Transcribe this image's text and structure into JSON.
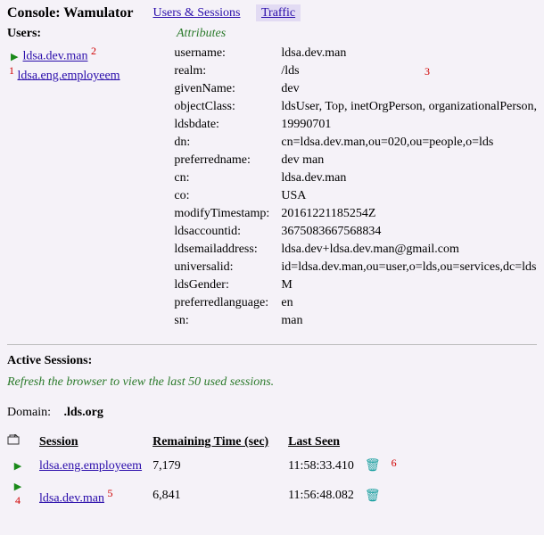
{
  "header": {
    "title": "Console: Wamulator"
  },
  "tabs": {
    "users_sessions": "Users & Sessions",
    "traffic": "Traffic"
  },
  "labels": {
    "users": "Users:",
    "attributes": "Attributes",
    "active_sessions": "Active Sessions:",
    "refresh_msg": "Refresh the browser to view the last 50 used sessions.",
    "domain": "Domain:"
  },
  "annotations": {
    "n1": "1",
    "n2": "2",
    "n3": "3",
    "n4": "4",
    "n5": "5",
    "n6": "6"
  },
  "users": {
    "items": [
      {
        "name": "ldsa.dev.man"
      },
      {
        "name": "ldsa.eng.employeem"
      }
    ]
  },
  "attributes": [
    {
      "key": "username:",
      "val": "ldsa.dev.man"
    },
    {
      "key": "realm:",
      "val": "/lds"
    },
    {
      "key": "givenName:",
      "val": "dev"
    },
    {
      "key": "objectClass:",
      "val": "ldsUser, Top, inetOrgPerson, organizationalPerson,"
    },
    {
      "key": "ldsbdate:",
      "val": "19990701"
    },
    {
      "key": "dn:",
      "val": "cn=ldsa.dev.man,ou=020,ou=people,o=lds"
    },
    {
      "key": "preferredname:",
      "val": "dev man"
    },
    {
      "key": "cn:",
      "val": "ldsa.dev.man"
    },
    {
      "key": "co:",
      "val": "USA"
    },
    {
      "key": "modifyTimestamp:",
      "val": "20161221185254Z"
    },
    {
      "key": "ldsaccountid:",
      "val": "3675083667568834"
    },
    {
      "key": "ldsemailaddress:",
      "val": "ldsa.dev+ldsa.dev.man@gmail.com"
    },
    {
      "key": "universalid:",
      "val": "id=ldsa.dev.man,ou=user,o=lds,ou=services,dc=lds"
    },
    {
      "key": "ldsGender:",
      "val": "M"
    },
    {
      "key": "preferredlanguage:",
      "val": "en"
    },
    {
      "key": "sn:",
      "val": "man"
    }
  ],
  "domain_value": ".lds.org",
  "sessions": {
    "headers": {
      "session": "Session",
      "remaining": "Remaining Time (sec)",
      "last_seen": "Last Seen"
    },
    "rows": [
      {
        "name": "ldsa.eng.employeem",
        "remaining": "7,179",
        "last_seen": "11:58:33.410"
      },
      {
        "name": "ldsa.dev.man",
        "remaining": "6,841",
        "last_seen": "11:56:48.082"
      }
    ]
  }
}
